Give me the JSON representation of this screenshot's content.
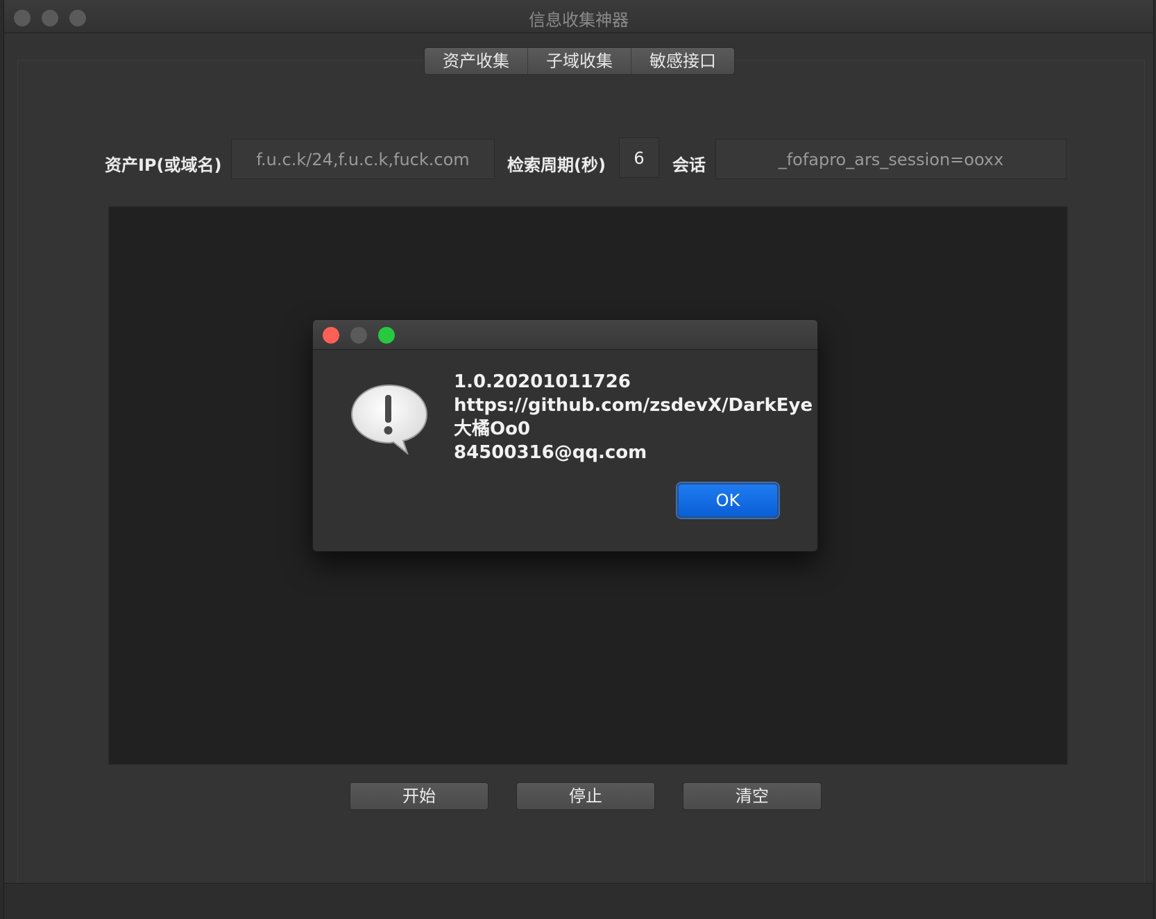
{
  "window": {
    "title": "信息收集神器"
  },
  "tabs": [
    {
      "label": "资产收集"
    },
    {
      "label": "子域收集"
    },
    {
      "label": "敏感接口"
    }
  ],
  "form": {
    "asset_label": "资产IP(或域名)",
    "asset_placeholder": "f.u.c.k/24,f.u.c.k,fuck.com",
    "period_label": "检索周期(秒)",
    "period_value": "6",
    "session_label": "会话",
    "session_placeholder": "_fofapro_ars_session=ooxx"
  },
  "buttons": {
    "start": "开始",
    "stop": "停止",
    "clear": "清空"
  },
  "dialog": {
    "lines": [
      "1.0.20201011726",
      "https://github.com/zsdevX/DarkEye",
      "大橘Oo0",
      "84500316@qq.com"
    ],
    "ok_label": "OK"
  },
  "icons": {
    "close": "close-icon",
    "minimize": "minimize-icon",
    "zoom": "zoom-icon",
    "alert": "alert-speech-bubble-icon"
  },
  "colors": {
    "accent": "#0a5fd6",
    "close": "#fe5f57",
    "minimize_disabled": "#5a5a5a",
    "zoom": "#28c840"
  }
}
